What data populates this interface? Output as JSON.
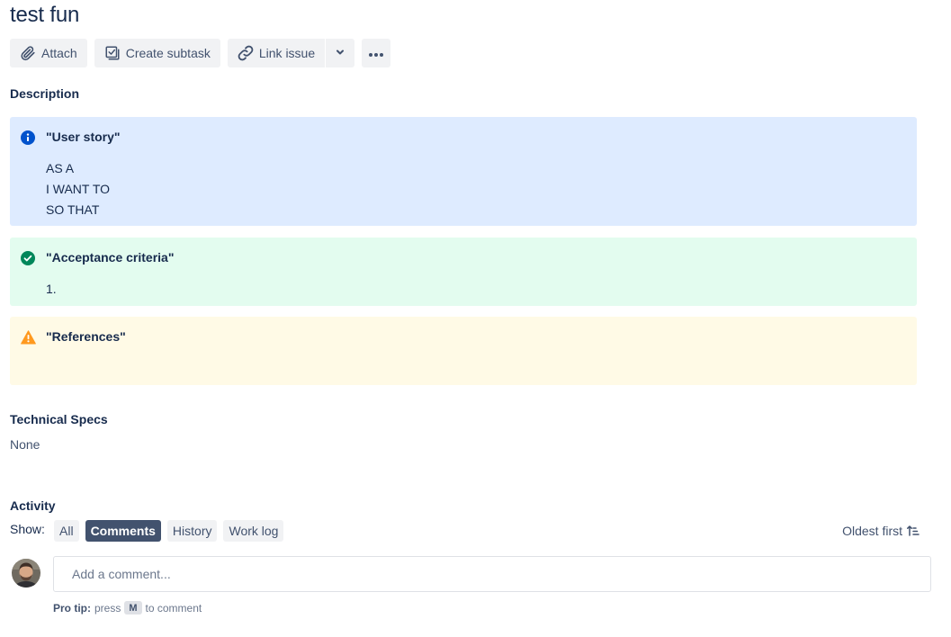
{
  "issue": {
    "title": "test fun"
  },
  "toolbar": {
    "attach_label": "Attach",
    "create_subtask_label": "Create subtask",
    "link_issue_label": "Link issue"
  },
  "description": {
    "label": "Description",
    "panels": [
      {
        "type": "info",
        "heading": "\"User story\"",
        "lines": [
          "AS A",
          "I WANT TO",
          "SO THAT"
        ],
        "color": "#deebff",
        "icon_color": "#0052cc"
      },
      {
        "type": "success",
        "heading": "\"Acceptance criteria\"",
        "lines": [
          "1."
        ],
        "color": "#e3fcef",
        "icon_color": "#00875a"
      },
      {
        "type": "warning",
        "heading": "\"References\"",
        "lines": [],
        "color": "#fffae6",
        "icon_color": "#ff991f"
      }
    ]
  },
  "technical_specs": {
    "label": "Technical Specs",
    "value": "None"
  },
  "activity": {
    "label": "Activity",
    "show_label": "Show:",
    "filters": [
      {
        "label": "All",
        "active": false
      },
      {
        "label": "Comments",
        "active": true
      },
      {
        "label": "History",
        "active": false
      },
      {
        "label": "Work log",
        "active": false
      }
    ],
    "sort_label": "Oldest first",
    "comment_placeholder": "Add a comment...",
    "pro_tip_label": "Pro tip:",
    "pro_tip_press": "press",
    "pro_tip_key": "M",
    "pro_tip_suffix": "to comment"
  }
}
